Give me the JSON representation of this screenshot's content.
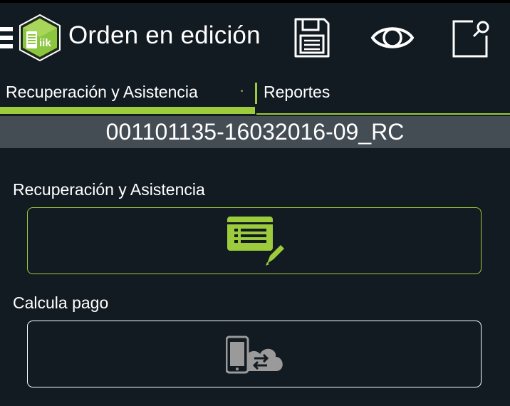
{
  "header": {
    "title": "Orden en edición",
    "logo_text": "iik",
    "icons": [
      "menu-icon",
      "save-icon",
      "eye-icon",
      "export-icon"
    ]
  },
  "tabs": [
    {
      "label": "Recuperación y Asistencia",
      "active": true
    },
    {
      "label": "Reportes",
      "active": false
    }
  ],
  "order": {
    "id": "001101135-16032016-09_RC"
  },
  "sections": [
    {
      "label": "Recuperación y Asistencia",
      "icon": "form-edit-icon"
    },
    {
      "label": "Calcula pago",
      "icon": "device-cloud-sync-icon"
    }
  ],
  "colors": {
    "background": "#121a22",
    "accent": "#9ccb3b",
    "order_bar": "#444c54",
    "icon_gray": "#9a9a9a"
  }
}
